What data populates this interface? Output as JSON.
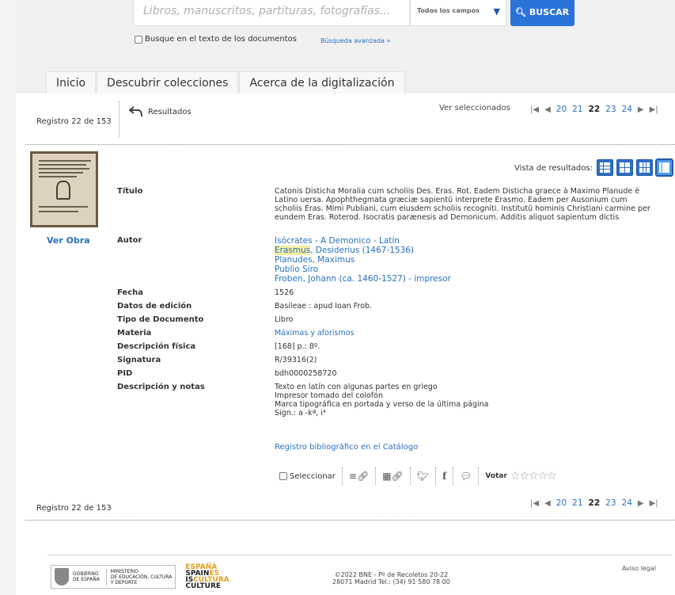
{
  "search": {
    "placeholder": "Libros, manuscritos, partituras, fotografías...",
    "field": "Todos los campos",
    "button": "BUSCAR",
    "fulltext_label": "Busque en el texto de los documentos",
    "advanced": "Búsqueda avanzada »"
  },
  "tabs": [
    "Inicio",
    "Descubrir colecciones",
    "Acerca de la digitalización"
  ],
  "nav": {
    "record_top": "Registro 22 de 153",
    "record_bottom": "Registro 22 de 153",
    "results_label": "Resultados",
    "ver_seleccionados": "Ver seleccionados",
    "pages": [
      "20",
      "21",
      "22",
      "23",
      "24"
    ],
    "current_page": "22"
  },
  "view": {
    "label": "Vista de resultados:"
  },
  "thumbnail": {
    "ver_obra": "Ver Obra"
  },
  "record": {
    "titulo_label": "Título",
    "titulo": "Catonis Disticha Moralia cum scholiis Des. Eras. Rot. Eadem Disticha graece à Maximo Planude è Latino uersa. Apophthegmata græciæ sapientũ interprete Erasmo. Eadem per Ausonium cum scholiis Eras. Mimi Publiani, cum eiusdem scholiis recogniti. Institutũ hominis Christiani carmine per eundem Eras. Roterod. Isocratis parænesis ad Demonicum. Additis aliquot sapientum dictis",
    "autor_label": "Autor",
    "autores": [
      "Isócrates - A Demonico - Latín",
      "Planudes, Maximus",
      "Publio Siro",
      "Froben, Johann (ca. 1460-1527) - impresor"
    ],
    "autor_highlight": "Erasmus",
    "autor_rest": ", Desiderius (1467-1536)",
    "fecha_label": "Fecha",
    "fecha": "1526",
    "edicion_label": "Datos de edición",
    "edicion": "Basileae : apud Ioan Frob.",
    "tipo_label": "Tipo de Documento",
    "tipo": "Libro",
    "materia_label": "Materia",
    "materia": "Máximas y aforismos",
    "fisica_label": "Descripción física",
    "fisica": "[168] p.; 8º.",
    "signatura_label": "Signatura",
    "signatura": "R/39316(2)",
    "pid_label": "PID",
    "pid": "bdh0000258720",
    "notas_label": "Descripción y notas",
    "notas": [
      "Texto en latín con algunas partes en griego",
      "Impresor tomado del colofón",
      "Marca tipográfica en portada y verso de la última página",
      "Sign.: a -kª, i⁴"
    ],
    "catalogo": "Registro bibliográfico en el Catálogo"
  },
  "toolbar": {
    "seleccionar": "Seleccionar",
    "votar": "Votar",
    "stars": "☆☆☆☆☆"
  },
  "footer": {
    "gobierno": [
      "GOBIERNO",
      "DE ESPAÑA"
    ],
    "ministerio": [
      "MINISTERIO",
      "DE EDUCACIÓN, CULTURA",
      "Y DEPORTE"
    ],
    "brand": [
      "ESPAÑA",
      "SPAIN",
      "ES",
      "IS",
      "CULTURA",
      "CULTURE"
    ],
    "address_1": "©2022 BNE - Pº de Recoletos 20-22",
    "address_2": "28071 Madrid Tel.: (34) 91 580 78 00",
    "aviso": "Aviso legal"
  },
  "colors": {
    "accent": "#2a73d9",
    "link": "#2a6fc0",
    "highlight": "#f4f0a0"
  }
}
